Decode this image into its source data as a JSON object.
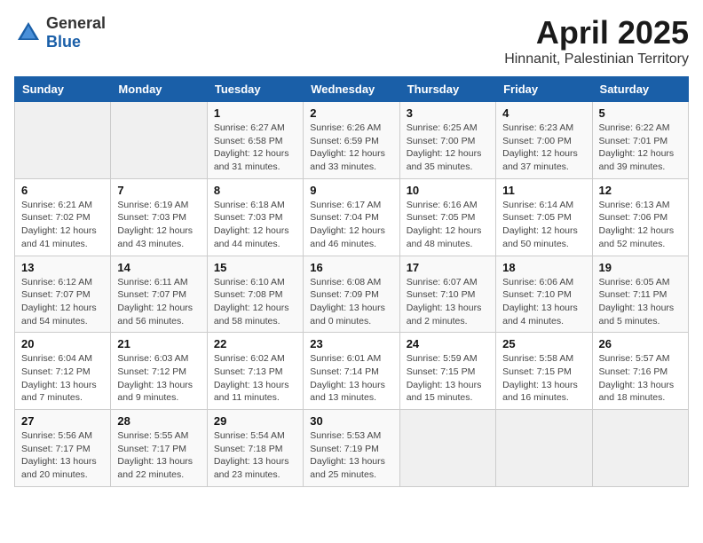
{
  "logo": {
    "general": "General",
    "blue": "Blue"
  },
  "title": "April 2025",
  "subtitle": "Hinnanit, Palestinian Territory",
  "weekdays": [
    "Sunday",
    "Monday",
    "Tuesday",
    "Wednesday",
    "Thursday",
    "Friday",
    "Saturday"
  ],
  "weeks": [
    [
      {
        "day": "",
        "info": ""
      },
      {
        "day": "",
        "info": ""
      },
      {
        "day": "1",
        "info": "Sunrise: 6:27 AM\nSunset: 6:58 PM\nDaylight: 12 hours\nand 31 minutes."
      },
      {
        "day": "2",
        "info": "Sunrise: 6:26 AM\nSunset: 6:59 PM\nDaylight: 12 hours\nand 33 minutes."
      },
      {
        "day": "3",
        "info": "Sunrise: 6:25 AM\nSunset: 7:00 PM\nDaylight: 12 hours\nand 35 minutes."
      },
      {
        "day": "4",
        "info": "Sunrise: 6:23 AM\nSunset: 7:00 PM\nDaylight: 12 hours\nand 37 minutes."
      },
      {
        "day": "5",
        "info": "Sunrise: 6:22 AM\nSunset: 7:01 PM\nDaylight: 12 hours\nand 39 minutes."
      }
    ],
    [
      {
        "day": "6",
        "info": "Sunrise: 6:21 AM\nSunset: 7:02 PM\nDaylight: 12 hours\nand 41 minutes."
      },
      {
        "day": "7",
        "info": "Sunrise: 6:19 AM\nSunset: 7:03 PM\nDaylight: 12 hours\nand 43 minutes."
      },
      {
        "day": "8",
        "info": "Sunrise: 6:18 AM\nSunset: 7:03 PM\nDaylight: 12 hours\nand 44 minutes."
      },
      {
        "day": "9",
        "info": "Sunrise: 6:17 AM\nSunset: 7:04 PM\nDaylight: 12 hours\nand 46 minutes."
      },
      {
        "day": "10",
        "info": "Sunrise: 6:16 AM\nSunset: 7:05 PM\nDaylight: 12 hours\nand 48 minutes."
      },
      {
        "day": "11",
        "info": "Sunrise: 6:14 AM\nSunset: 7:05 PM\nDaylight: 12 hours\nand 50 minutes."
      },
      {
        "day": "12",
        "info": "Sunrise: 6:13 AM\nSunset: 7:06 PM\nDaylight: 12 hours\nand 52 minutes."
      }
    ],
    [
      {
        "day": "13",
        "info": "Sunrise: 6:12 AM\nSunset: 7:07 PM\nDaylight: 12 hours\nand 54 minutes."
      },
      {
        "day": "14",
        "info": "Sunrise: 6:11 AM\nSunset: 7:07 PM\nDaylight: 12 hours\nand 56 minutes."
      },
      {
        "day": "15",
        "info": "Sunrise: 6:10 AM\nSunset: 7:08 PM\nDaylight: 12 hours\nand 58 minutes."
      },
      {
        "day": "16",
        "info": "Sunrise: 6:08 AM\nSunset: 7:09 PM\nDaylight: 13 hours\nand 0 minutes."
      },
      {
        "day": "17",
        "info": "Sunrise: 6:07 AM\nSunset: 7:10 PM\nDaylight: 13 hours\nand 2 minutes."
      },
      {
        "day": "18",
        "info": "Sunrise: 6:06 AM\nSunset: 7:10 PM\nDaylight: 13 hours\nand 4 minutes."
      },
      {
        "day": "19",
        "info": "Sunrise: 6:05 AM\nSunset: 7:11 PM\nDaylight: 13 hours\nand 5 minutes."
      }
    ],
    [
      {
        "day": "20",
        "info": "Sunrise: 6:04 AM\nSunset: 7:12 PM\nDaylight: 13 hours\nand 7 minutes."
      },
      {
        "day": "21",
        "info": "Sunrise: 6:03 AM\nSunset: 7:12 PM\nDaylight: 13 hours\nand 9 minutes."
      },
      {
        "day": "22",
        "info": "Sunrise: 6:02 AM\nSunset: 7:13 PM\nDaylight: 13 hours\nand 11 minutes."
      },
      {
        "day": "23",
        "info": "Sunrise: 6:01 AM\nSunset: 7:14 PM\nDaylight: 13 hours\nand 13 minutes."
      },
      {
        "day": "24",
        "info": "Sunrise: 5:59 AM\nSunset: 7:15 PM\nDaylight: 13 hours\nand 15 minutes."
      },
      {
        "day": "25",
        "info": "Sunrise: 5:58 AM\nSunset: 7:15 PM\nDaylight: 13 hours\nand 16 minutes."
      },
      {
        "day": "26",
        "info": "Sunrise: 5:57 AM\nSunset: 7:16 PM\nDaylight: 13 hours\nand 18 minutes."
      }
    ],
    [
      {
        "day": "27",
        "info": "Sunrise: 5:56 AM\nSunset: 7:17 PM\nDaylight: 13 hours\nand 20 minutes."
      },
      {
        "day": "28",
        "info": "Sunrise: 5:55 AM\nSunset: 7:17 PM\nDaylight: 13 hours\nand 22 minutes."
      },
      {
        "day": "29",
        "info": "Sunrise: 5:54 AM\nSunset: 7:18 PM\nDaylight: 13 hours\nand 23 minutes."
      },
      {
        "day": "30",
        "info": "Sunrise: 5:53 AM\nSunset: 7:19 PM\nDaylight: 13 hours\nand 25 minutes."
      },
      {
        "day": "",
        "info": ""
      },
      {
        "day": "",
        "info": ""
      },
      {
        "day": "",
        "info": ""
      }
    ]
  ]
}
